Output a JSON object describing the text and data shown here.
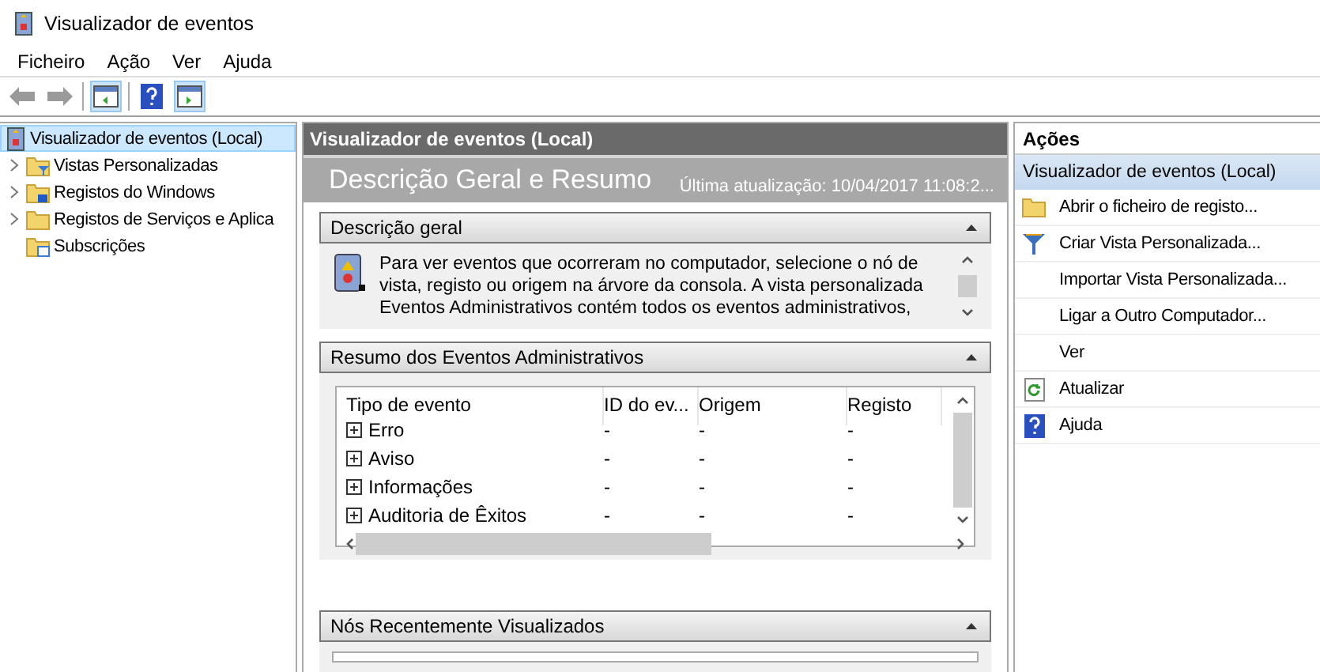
{
  "window": {
    "title": "Visualizador de eventos"
  },
  "menu": [
    "Ficheiro",
    "Ação",
    "Ver",
    "Ajuda"
  ],
  "tree": {
    "label": "Visualizador de eventos (Local)",
    "selected": true,
    "children": [
      {
        "label": "Vistas Personalizadas",
        "kind": "filter-folder",
        "expandable": true,
        "selected": false
      },
      {
        "label": "Registos do Windows",
        "kind": "windows-folder",
        "expandable": true,
        "selected": false
      },
      {
        "label": "Registos de Serviços e Aplica",
        "kind": "folder",
        "expandable": true,
        "selected": false
      },
      {
        "label": "Subscrições",
        "kind": "subscription-folder",
        "expandable": false,
        "selected": false
      }
    ]
  },
  "center": {
    "header": "Visualizador de eventos (Local)",
    "title": "Descrição Geral e Resumo",
    "updated": "Última atualização: 10/04/2017 11:08:2...",
    "overview": {
      "title": "Descrição geral",
      "text": "Para ver eventos que ocorreram no computador, selecione o nó de vista, registo ou origem na árvore da consola. A vista personalizada Eventos Administrativos contém todos os eventos administrativos,"
    },
    "summary": {
      "title": "Resumo dos Eventos Administrativos",
      "columns": [
        "Tipo de evento",
        "ID do ev...",
        "Origem",
        "Registo"
      ],
      "rows": [
        {
          "cells": [
            "Erro",
            "-",
            "-",
            "-"
          ],
          "expanded": false
        },
        {
          "cells": [
            "Aviso",
            "-",
            "-",
            "-"
          ],
          "expanded": false
        },
        {
          "cells": [
            "Informações",
            "-",
            "-",
            "-"
          ],
          "expanded": false
        },
        {
          "cells": [
            "Auditoria de Êxitos",
            "-",
            "-",
            "-"
          ],
          "expanded": false
        }
      ]
    },
    "recent": {
      "title": "Nós Recentemente Visualizados"
    }
  },
  "actions": {
    "title": "Ações",
    "group": "Visualizador de eventos (Local)",
    "items": [
      {
        "label": "Abrir o ficheiro de registo...",
        "kind": "folder"
      },
      {
        "label": "Criar Vista Personalizada...",
        "kind": "filter"
      },
      {
        "label": "Importar Vista Personalizada...",
        "kind": "plain"
      },
      {
        "label": "Ligar a Outro Computador...",
        "kind": "plain"
      },
      {
        "label": "Ver",
        "kind": "plain"
      },
      {
        "label": "Atualizar",
        "kind": "refresh"
      },
      {
        "label": "Ajuda",
        "kind": "help"
      }
    ]
  }
}
